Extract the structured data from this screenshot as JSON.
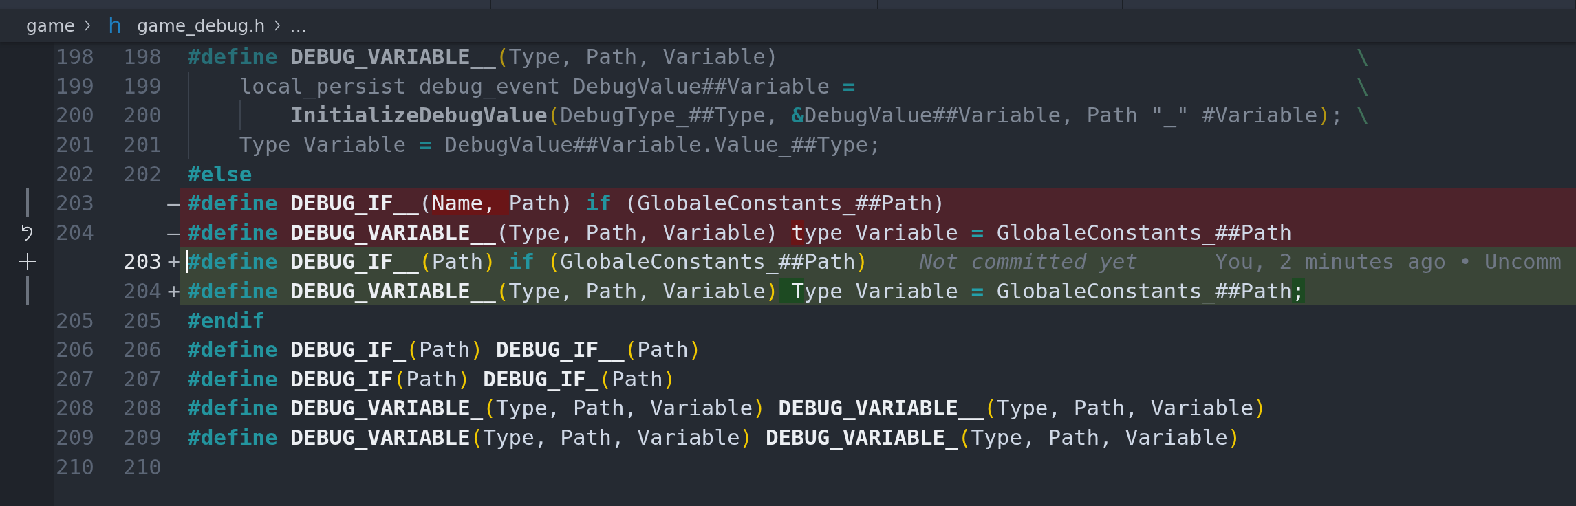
{
  "breadcrumb": {
    "folder": "game",
    "file_icon": "h",
    "file": "game_debug.h",
    "more": "…"
  },
  "lines": [
    {
      "old": "198",
      "new": "198",
      "kind": "context",
      "inactive": true,
      "tokens": [
        {
          "kind": "kw",
          "text": "#define "
        },
        {
          "kind": "macro",
          "text": "DEBUG_VARIABLE__"
        },
        {
          "kind": "paren",
          "text": "("
        },
        {
          "kind": "plain",
          "text": "Type, Path, Variable)"
        },
        {
          "kind": "cont",
          "text": "\\"
        }
      ],
      "children": [
        {
          "old": "199",
          "new": "199",
          "inactive": true,
          "tokens": [
            {
              "kind": "plain",
              "text": "local_persist debug_event DebugValue##Variable "
            },
            {
              "kind": "op",
              "text": "="
            },
            {
              "kind": "cont",
              "text": "\\"
            }
          ],
          "children": [
            {
              "old": "200",
              "new": "200",
              "inactive": true,
              "tokens": [
                {
                  "kind": "macro",
                  "text": "InitializeDebugValue"
                },
                {
                  "kind": "paren",
                  "text": "("
                },
                {
                  "kind": "plain",
                  "text": "DebugType_##Type, "
                },
                {
                  "kind": "op",
                  "text": "&"
                },
                {
                  "kind": "plain",
                  "text": "DebugValue##Variable, Path "
                },
                {
                  "kind": "str",
                  "text": "\"_\""
                },
                {
                  "kind": "plain",
                  "text": " #Variable"
                },
                {
                  "kind": "paren",
                  "text": ")"
                },
                {
                  "kind": "plain",
                  "text": ";"
                },
                {
                  "kind": "cont",
                  "text": "\\"
                }
              ]
            }
          ]
        },
        {
          "old": "201",
          "new": "201",
          "inactive": true,
          "tokens": [
            {
              "kind": "plain",
              "text": "Type Variable "
            },
            {
              "kind": "op",
              "text": "="
            },
            {
              "kind": "plain",
              "text": " DebugValue##Variable.Value_##Type;"
            }
          ]
        }
      ]
    },
    {
      "old": "202",
      "new": "202",
      "kind": "context",
      "tokens": [
        {
          "kind": "kw",
          "text": "#else"
        }
      ]
    },
    {
      "old": "203",
      "kind": "removed",
      "sign": "—",
      "gutter": {
        "kind": "bar"
      },
      "tokens": [
        {
          "kind": "kw",
          "text": "#define "
        },
        {
          "kind": "macro",
          "text": "DEBUG_IF__"
        },
        {
          "kind": "plain",
          "text": "("
        },
        {
          "kind": "changed",
          "text": "Name, "
        },
        {
          "kind": "plain",
          "text": "Path) "
        },
        {
          "kind": "kw",
          "text": "if"
        },
        {
          "kind": "plain",
          "text": " (GlobaleConstants_##Path)"
        }
      ]
    },
    {
      "old": "204",
      "kind": "removed",
      "sign": "—",
      "gutter": {
        "kind": "revert"
      },
      "tokens": [
        {
          "kind": "kw",
          "text": "#define "
        },
        {
          "kind": "macro",
          "text": "DEBUG_VARIABLE__"
        },
        {
          "kind": "plain",
          "text": "(Type, Path, Variable) "
        },
        {
          "kind": "changed",
          "text": "t"
        },
        {
          "kind": "plain",
          "text": "ype Variable "
        },
        {
          "kind": "op",
          "text": "="
        },
        {
          "kind": "plain",
          "text": " GlobaleConstants_##Path"
        }
      ]
    },
    {
      "new": "203",
      "kind": "added",
      "sign": "+",
      "gutter": {
        "kind": "add"
      },
      "current": true,
      "tokens": [
        {
          "kind": "kw",
          "text": "#define "
        },
        {
          "kind": "macro",
          "text": "DEBUG_IF__"
        },
        {
          "kind": "paren",
          "text": "("
        },
        {
          "kind": "plain",
          "text": "Path"
        },
        {
          "kind": "paren",
          "text": ")"
        },
        {
          "kind": "kw",
          "text": " if "
        },
        {
          "kind": "paren",
          "text": "("
        },
        {
          "kind": "plain",
          "text": "GlobaleConstants_##Path"
        },
        {
          "kind": "paren",
          "text": ")"
        }
      ],
      "blame": [
        "Not committed yet",
        "You, 2 minutes ago • Uncomm"
      ]
    },
    {
      "new": "204",
      "kind": "added",
      "sign": "+",
      "gutter": {
        "kind": "bar"
      },
      "tokens": [
        {
          "kind": "kw",
          "text": "#define "
        },
        {
          "kind": "macro",
          "text": "DEBUG_VARIABLE__"
        },
        {
          "kind": "paren",
          "text": "("
        },
        {
          "kind": "plain",
          "text": "Type, Path, Variable"
        },
        {
          "kind": "paren",
          "text": ")"
        },
        {
          "kind": "changed",
          "text": " T"
        },
        {
          "kind": "plain",
          "text": "ype Variable "
        },
        {
          "kind": "op",
          "text": "="
        },
        {
          "kind": "plain",
          "text": " GlobaleConstants_##Path"
        },
        {
          "kind": "changed",
          "text": ";"
        }
      ]
    },
    {
      "old": "205",
      "new": "205",
      "kind": "context",
      "tokens": [
        {
          "kind": "kw",
          "text": "#endif"
        }
      ]
    },
    {
      "old": "206",
      "new": "206",
      "kind": "context",
      "tokens": [
        {
          "kind": "kw",
          "text": "#define "
        },
        {
          "kind": "macro",
          "text": "DEBUG_IF_"
        },
        {
          "kind": "paren",
          "text": "("
        },
        {
          "kind": "plain",
          "text": "Path"
        },
        {
          "kind": "paren",
          "text": ")"
        },
        {
          "kind": "macro",
          "text": " DEBUG_IF__"
        },
        {
          "kind": "paren",
          "text": "("
        },
        {
          "kind": "plain",
          "text": "Path"
        },
        {
          "kind": "paren",
          "text": ")"
        }
      ]
    },
    {
      "old": "207",
      "new": "207",
      "kind": "context",
      "tokens": [
        {
          "kind": "kw",
          "text": "#define "
        },
        {
          "kind": "macro",
          "text": "DEBUG_IF"
        },
        {
          "kind": "paren",
          "text": "("
        },
        {
          "kind": "plain",
          "text": "Path"
        },
        {
          "kind": "paren",
          "text": ")"
        },
        {
          "kind": "macro",
          "text": " DEBUG_IF_"
        },
        {
          "kind": "paren",
          "text": "("
        },
        {
          "kind": "plain",
          "text": "Path"
        },
        {
          "kind": "paren",
          "text": ")"
        }
      ]
    },
    {
      "old": "208",
      "new": "208",
      "kind": "context",
      "tokens": [
        {
          "kind": "kw",
          "text": "#define "
        },
        {
          "kind": "macro",
          "text": "DEBUG_VARIABLE_"
        },
        {
          "kind": "paren",
          "text": "("
        },
        {
          "kind": "plain",
          "text": "Type, Path, Variable"
        },
        {
          "kind": "paren",
          "text": ")"
        },
        {
          "kind": "macro",
          "text": " DEBUG_VARIABLE__"
        },
        {
          "kind": "paren",
          "text": "("
        },
        {
          "kind": "plain",
          "text": "Type, Path, Variable"
        },
        {
          "kind": "paren",
          "text": ")"
        }
      ]
    },
    {
      "old": "209",
      "new": "209",
      "kind": "context",
      "tokens": [
        {
          "kind": "kw",
          "text": "#define "
        },
        {
          "kind": "macro",
          "text": "DEBUG_VARIABLE"
        },
        {
          "kind": "paren",
          "text": "("
        },
        {
          "kind": "plain",
          "text": "Type, Path, Variable"
        },
        {
          "kind": "paren",
          "text": ")"
        },
        {
          "kind": "macro",
          "text": " DEBUG_VARIABLE_"
        },
        {
          "kind": "paren",
          "text": "("
        },
        {
          "kind": "plain",
          "text": "Type, Path, Variable"
        },
        {
          "kind": "paren",
          "text": ")"
        }
      ]
    },
    {
      "old": "210",
      "new": "210",
      "kind": "context"
    }
  ]
}
